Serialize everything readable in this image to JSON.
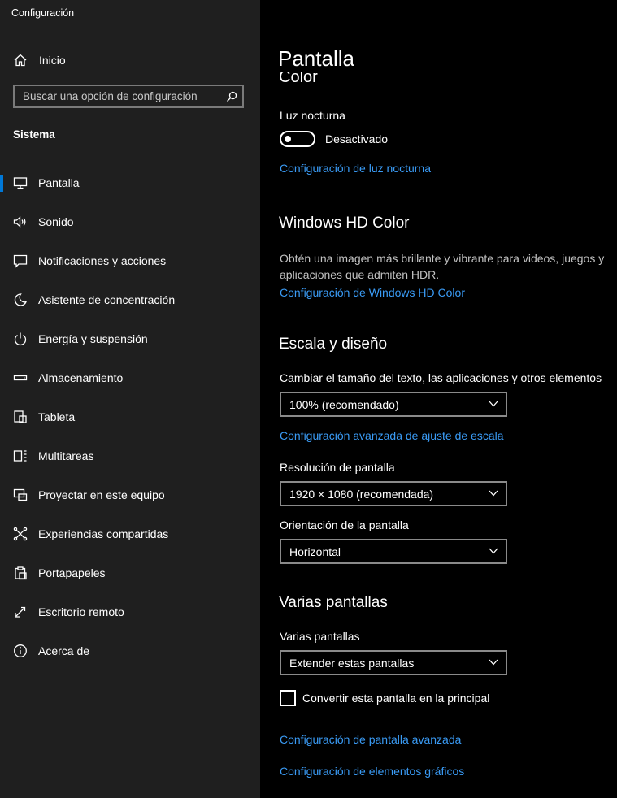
{
  "app": {
    "title": "Configuración"
  },
  "sidebar": {
    "home_label": "Inicio",
    "search_placeholder": "Buscar una opción de configuración",
    "section_title": "Sistema",
    "items": [
      {
        "label": "Pantalla",
        "icon": "monitor-icon",
        "active": true
      },
      {
        "label": "Sonido",
        "icon": "speaker-icon"
      },
      {
        "label": "Notificaciones y acciones",
        "icon": "notification-icon"
      },
      {
        "label": "Asistente de concentración",
        "icon": "moon-icon"
      },
      {
        "label": "Energía y suspensión",
        "icon": "power-icon"
      },
      {
        "label": "Almacenamiento",
        "icon": "storage-icon"
      },
      {
        "label": "Tableta",
        "icon": "tablet-icon"
      },
      {
        "label": "Multitareas",
        "icon": "multitask-icon"
      },
      {
        "label": "Proyectar en este equipo",
        "icon": "project-icon"
      },
      {
        "label": "Experiencias compartidas",
        "icon": "share-icon"
      },
      {
        "label": "Portapapeles",
        "icon": "clipboard-icon"
      },
      {
        "label": "Escritorio remoto",
        "icon": "remote-desktop-icon"
      },
      {
        "label": "Acerca de",
        "icon": "info-icon"
      }
    ]
  },
  "main": {
    "page_title": "Pantalla",
    "color_heading": "Color",
    "night_light": {
      "label": "Luz nocturna",
      "state": "Desactivado",
      "settings_link": "Configuración de luz nocturna"
    },
    "hd_color": {
      "heading": "Windows HD Color",
      "description": "Obtén una imagen más brillante y vibrante para videos, juegos y aplicaciones que admiten HDR.",
      "link": "Configuración de Windows HD Color"
    },
    "scale_layout": {
      "heading": "Escala y diseño",
      "scale_label": "Cambiar el tamaño del texto, las aplicaciones y otros elementos",
      "scale_value": "100% (recomendado)",
      "advanced_link": "Configuración avanzada de ajuste de escala",
      "resolution_label": "Resolución de pantalla",
      "resolution_value": "1920 × 1080 (recomendada)",
      "orientation_label": "Orientación de la pantalla",
      "orientation_value": "Horizontal"
    },
    "multi_display": {
      "heading": "Varias pantallas",
      "label": "Varias pantallas",
      "value": "Extender estas pantallas",
      "make_main_label": "Convertir esta pantalla en la principal",
      "advanced_display_link": "Configuración de pantalla avanzada",
      "graphics_link": "Configuración de elementos gráficos"
    }
  },
  "colors": {
    "accent": "#0078d7",
    "link": "#3a9bf5",
    "sidebar_bg": "#1f1f1f",
    "main_bg": "#000000"
  }
}
